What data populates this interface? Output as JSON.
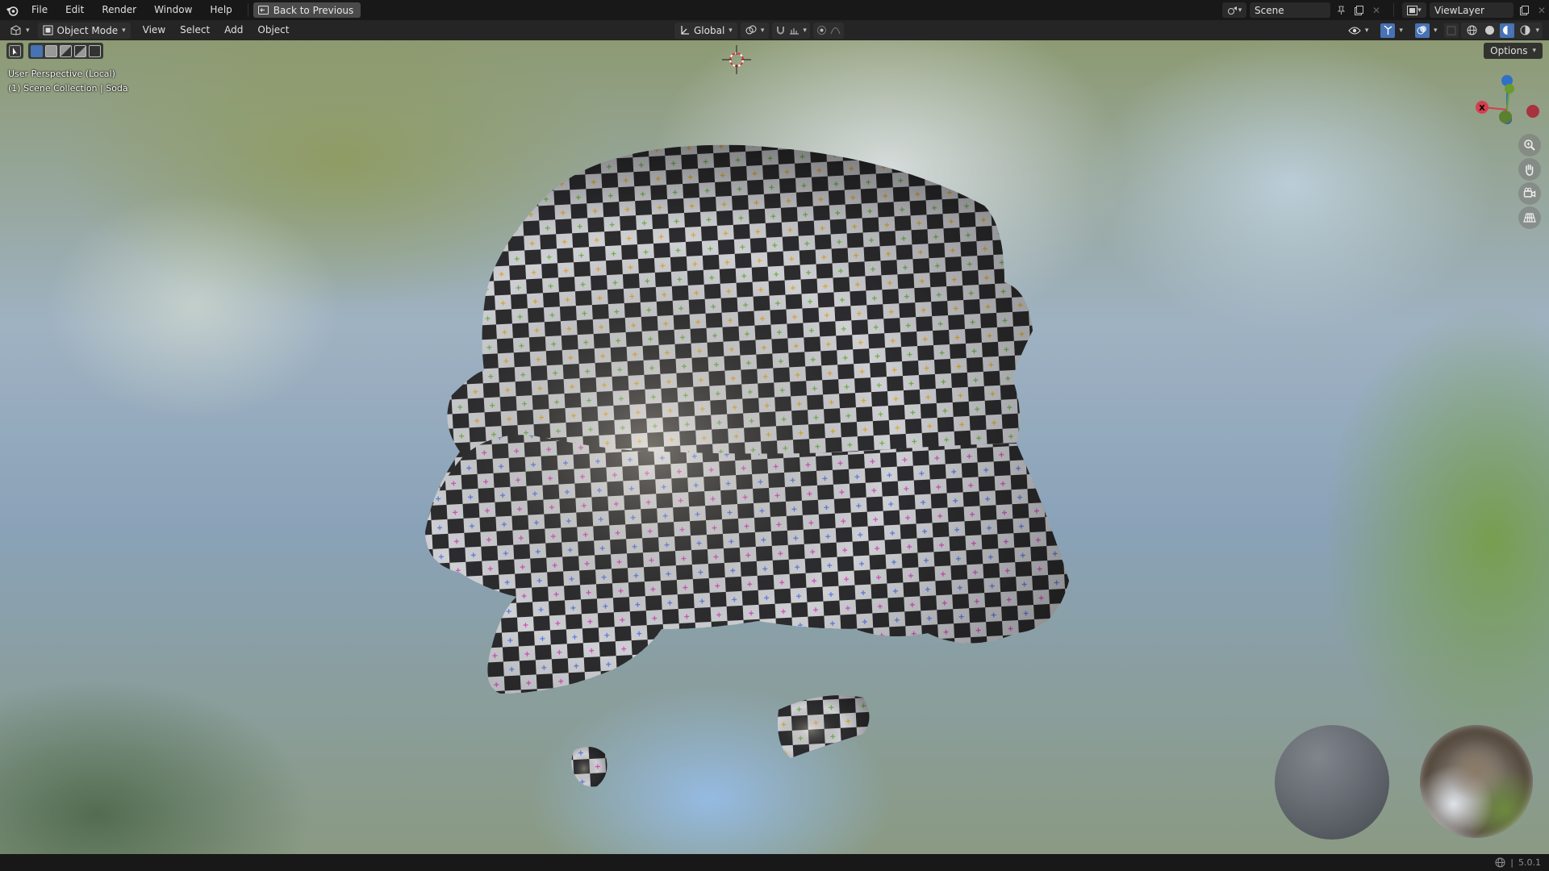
{
  "topbar": {
    "menus": [
      "File",
      "Edit",
      "Render",
      "Window",
      "Help"
    ],
    "back_button": "Back to Previous",
    "scene_name": "Scene",
    "view_layer_name": "ViewLayer"
  },
  "viewport_header": {
    "mode": "Object Mode",
    "menus": [
      "View",
      "Select",
      "Add",
      "Object"
    ],
    "transform_orientation": "Global"
  },
  "viewport": {
    "perspective_label": "User Perspective (Local)",
    "collection_label": "(1) Scene Collection | Soda",
    "options_label": "Options",
    "gizmo": {
      "x_label": "X",
      "x_color": "#d63e50",
      "y_color": "#6a9b2c",
      "z_color": "#3070c8"
    },
    "object_name": "Soda"
  },
  "statusbar": {
    "version": "5.0.1"
  },
  "colors": {
    "accent": "#4772b3",
    "header_bg": "#262626",
    "topbar_bg": "#181818"
  }
}
